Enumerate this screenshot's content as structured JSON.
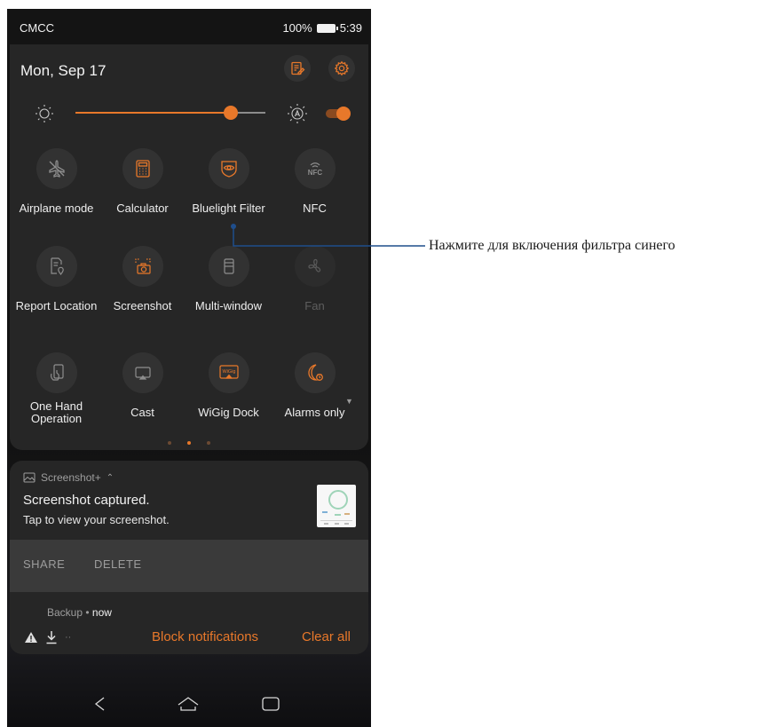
{
  "status_bar": {
    "carrier": "CMCC",
    "battery": "100%",
    "time": "5:39"
  },
  "header": {
    "date": "Mon, Sep 17",
    "edit_icon": "edit-icon",
    "settings_icon": "gear-icon"
  },
  "brightness": {
    "level": 0.82,
    "auto_icon": "auto-brightness-icon",
    "auto_enabled": true
  },
  "tiles": [
    {
      "label": "Airplane mode",
      "icon": "airplane-icon",
      "active": false
    },
    {
      "label": "Calculator",
      "icon": "calculator-icon",
      "active": true
    },
    {
      "label": "Bluelight Filter",
      "icon": "eye-icon",
      "active": true
    },
    {
      "label": "NFC",
      "icon": "nfc-icon",
      "active": false
    },
    {
      "label": "Report Location",
      "icon": "report-location-icon",
      "active": false
    },
    {
      "label": "Screenshot",
      "icon": "screenshot-icon",
      "active": true
    },
    {
      "label": "Multi-window",
      "icon": "multi-window-icon",
      "active": false
    },
    {
      "label": "Fan",
      "icon": "fan-icon",
      "active": false,
      "disabled": true
    },
    {
      "label": "One Hand Operation",
      "icon": "one-hand-icon",
      "active": false
    },
    {
      "label": "Cast",
      "icon": "cast-icon",
      "active": false
    },
    {
      "label": "WiGig Dock",
      "icon": "wigig-icon",
      "active": true
    },
    {
      "label": "Alarms only",
      "icon": "moon-alarm-icon",
      "active": true
    }
  ],
  "page_indicator": {
    "count": 3,
    "active": 1
  },
  "screenshot_notification": {
    "app": "Screenshot+",
    "title": "Screenshot captured.",
    "subtitle": "Tap to view your screenshot.",
    "actions": {
      "share": "SHARE",
      "delete": "DELETE"
    }
  },
  "backup_notification": {
    "app": "Backup",
    "separator": " • ",
    "time": "now",
    "block": "Block notifications",
    "clear": "Clear all"
  },
  "callout": {
    "text": "Нажмите для включения фильтра синего"
  },
  "colors": {
    "accent": "#e8782a",
    "panel": "#262626",
    "callout_line": "#1f4e8c"
  }
}
